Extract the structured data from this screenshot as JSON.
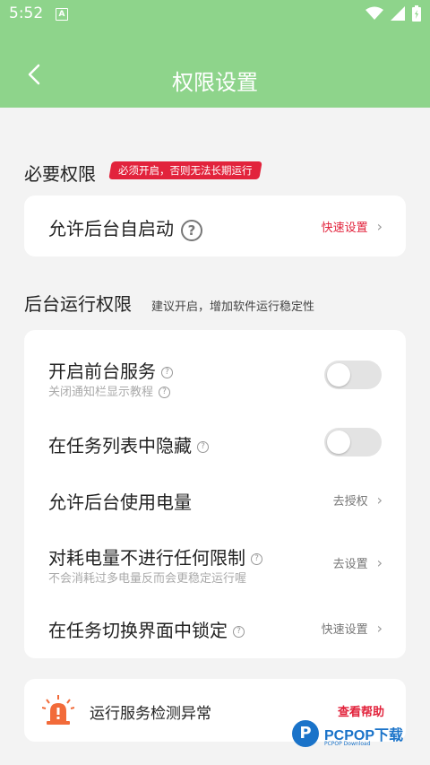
{
  "status_bar": {
    "time": "5:52",
    "a_badge": "A"
  },
  "header": {
    "title": "权限设置",
    "back_icon": "chevron-left-icon"
  },
  "required_section": {
    "title": "必要权限",
    "badge": "必须开启，否则无法长期运行",
    "items": [
      {
        "label": "允许后台自启动",
        "help": "?",
        "action": "快速设置"
      }
    ]
  },
  "background_section": {
    "title": "后台运行权限",
    "hint": "建议开启，增加软件运行稳定性",
    "items": [
      {
        "label": "开启前台服务",
        "sub": "关闭通知栏显示教程",
        "toggle_on": false
      },
      {
        "label": "在任务列表中隐藏",
        "toggle_on": false
      },
      {
        "label": "允许后台使用电量",
        "action": "去授权"
      },
      {
        "label": "对耗电量不进行任何限制",
        "sub": "不会消耗过多电量反而会更稳定运行喔",
        "action": "去设置"
      },
      {
        "label": "在任务切换界面中锁定",
        "action": "快速设置"
      }
    ]
  },
  "alert_card": {
    "label": "运行服务检测异常",
    "action": "查看帮助"
  },
  "watermark": {
    "logo": "P",
    "text": "PCPOP下载",
    "sub": "PCPOP Download"
  },
  "colors": {
    "accent_green": "#8ed48b",
    "warning_red": "#e2233c"
  }
}
